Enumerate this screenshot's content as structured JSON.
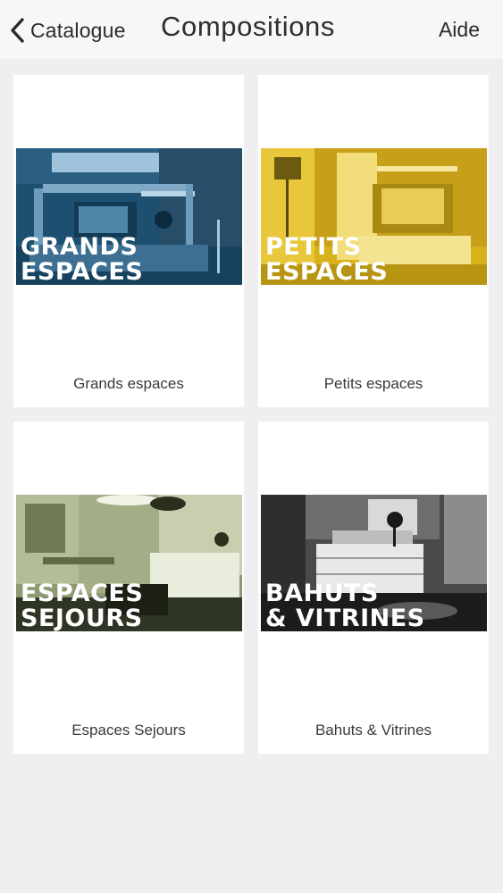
{
  "nav": {
    "back_label": "Catalogue",
    "title": "Compositions",
    "help_label": "Aide"
  },
  "cards": [
    {
      "overlay_line1": "GRANDS",
      "overlay_line2": "ESPACES",
      "caption": "Grands espaces",
      "tint": "#1e5f86"
    },
    {
      "overlay_line1": "PETITS",
      "overlay_line2": "ESPACES",
      "caption": "Petits espaces",
      "tint": "#e6c01a"
    },
    {
      "overlay_line1": "ESPACES",
      "overlay_line2": "SEJOURS",
      "caption": "Espaces Sejours",
      "tint": "#a9b489"
    },
    {
      "overlay_line1": "BAHUTS",
      "overlay_line2": "& VITRINES",
      "caption": "Bahuts & Vitrines",
      "tint": "#3a3a3a"
    }
  ],
  "icons": {
    "back": "chevron-left-icon"
  }
}
